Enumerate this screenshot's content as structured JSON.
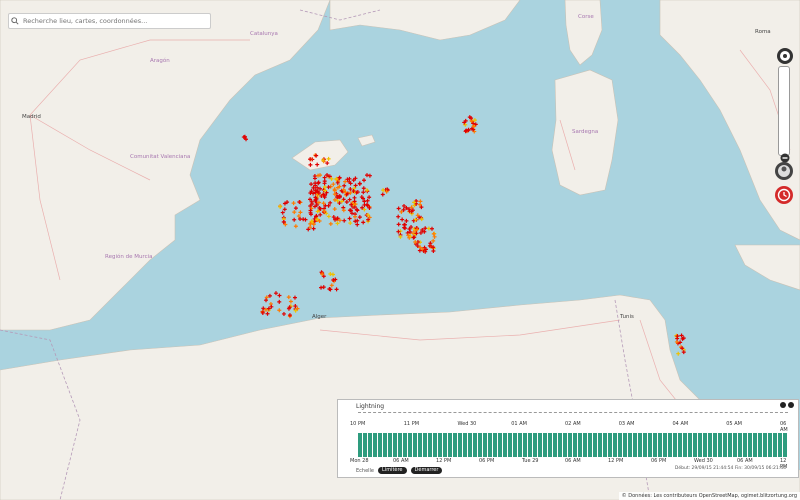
{
  "search": {
    "placeholder": "Recherche lieu, cartes, coordonnées..."
  },
  "map": {
    "labels": [
      {
        "text": "Madrid",
        "kind": "city"
      },
      {
        "text": "Aragón",
        "kind": "region"
      },
      {
        "text": "Catalunya",
        "kind": "region"
      },
      {
        "text": "Comunitat Valenciana",
        "kind": "region"
      },
      {
        "text": "Región de Murcia",
        "kind": "region"
      },
      {
        "text": "Sardegna",
        "kind": "region"
      },
      {
        "text": "Corse",
        "kind": "region"
      },
      {
        "text": "Roma",
        "kind": "city"
      },
      {
        "text": "Alger",
        "kind": "city"
      },
      {
        "text": "Tunis",
        "kind": "city"
      }
    ]
  },
  "timeline": {
    "title": "Lightning",
    "top_ticks": [
      "10 PM",
      "11 PM",
      "Wed 30",
      "01 AM",
      "02 AM",
      "03 AM",
      "04 AM",
      "05 AM",
      "06 AM"
    ],
    "bottom_ticks": [
      "Mon 28",
      "06 AM",
      "12 PM",
      "06 PM",
      "Tue 29",
      "06 AM",
      "12 PM",
      "06 PM",
      "Wed 30",
      "06 AM",
      "12 PM"
    ],
    "foot_label": "Echelle",
    "btn_prev": "Limitère",
    "btn_next": "Démarrer",
    "range_text": "Début: 29/09/15 21:44:54 Fin: 30/09/15 06:21:44",
    "bar_color": "#2e9c7e"
  },
  "attribution": "© Données: Les contributeurs OpenStreetMap, ogimet.blitzortung.org",
  "colors": {
    "sea": "#aad3df",
    "land": "#f2efe9",
    "strike_recent": "#e00000",
    "strike_old": "#f0c000"
  }
}
